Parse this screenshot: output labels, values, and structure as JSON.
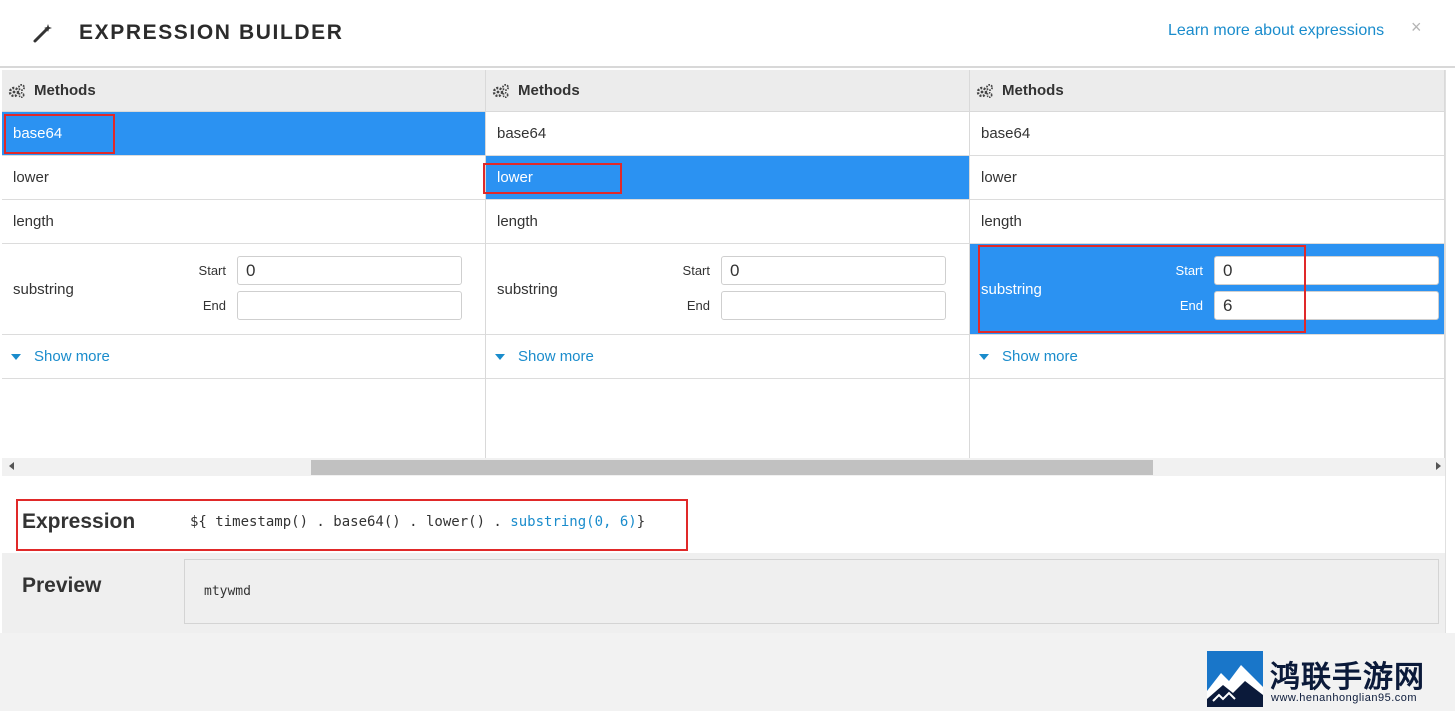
{
  "header": {
    "title": "EXPRESSION BUILDER",
    "learn_more": "Learn more about expressions",
    "close_glyph": "×",
    "icons": {
      "wand": "magic-wand-icon",
      "close": "close-icon"
    }
  },
  "columns": [
    {
      "heading": "Methods",
      "items": {
        "base64": "base64",
        "lower": "lower",
        "length": "length",
        "substring": "substring"
      },
      "selected": "base64",
      "substring_fields": {
        "start_label": "Start",
        "start_value": "0",
        "end_label": "End",
        "end_value": ""
      },
      "show_more": "Show more"
    },
    {
      "heading": "Methods",
      "items": {
        "base64": "base64",
        "lower": "lower",
        "length": "length",
        "substring": "substring"
      },
      "selected": "lower",
      "substring_fields": {
        "start_label": "Start",
        "start_value": "0",
        "end_label": "End",
        "end_value": ""
      },
      "show_more": "Show more"
    },
    {
      "heading": "Methods",
      "items": {
        "base64": "base64",
        "lower": "lower",
        "length": "length",
        "substring": "substring"
      },
      "selected": "substring",
      "substring_fields": {
        "start_label": "Start",
        "start_value": "0",
        "end_label": "End",
        "end_value": "6"
      },
      "show_more": "Show more"
    }
  ],
  "expression": {
    "label": "Expression",
    "prefix": "${ timestamp() . base64() . lower() . ",
    "highlight": "substring(0, 6)",
    "suffix": "}"
  },
  "preview": {
    "label": "Preview",
    "value": "mtywmd"
  },
  "watermark": {
    "title": "鸿联手游网",
    "url": "www.henanhonglian95.com"
  },
  "colors": {
    "selected": "#2b92f2",
    "link": "#1a8ccc",
    "highlight_border": "#e02929"
  }
}
